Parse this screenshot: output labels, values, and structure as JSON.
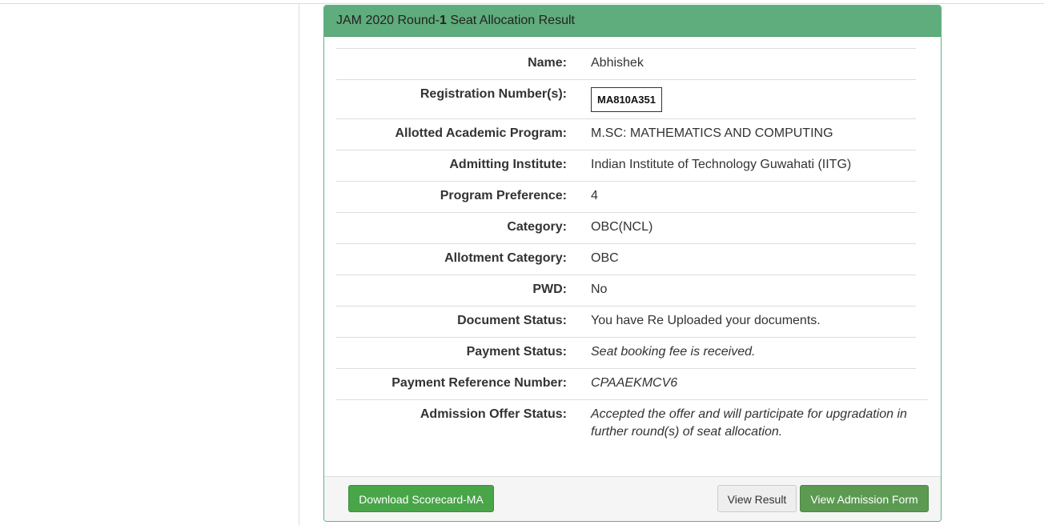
{
  "panel": {
    "title_prefix": "JAM 2020 Round-",
    "title_round": "1",
    "title_suffix": " Seat Allocation Result"
  },
  "fields": {
    "name": {
      "label": "Name:",
      "value": "Abhishek"
    },
    "registration": {
      "label": "Registration Number(s):",
      "value": "MA810A351"
    },
    "program": {
      "label": "Allotted Academic Program:",
      "value": "M.SC: MATHEMATICS AND COMPUTING"
    },
    "institute": {
      "label": "Admitting Institute:",
      "value": "Indian Institute of Technology Guwahati (IITG)"
    },
    "preference": {
      "label": "Program Preference:",
      "value": "4"
    },
    "category": {
      "label": "Category:",
      "value": "OBC(NCL)"
    },
    "allotment_category": {
      "label": "Allotment Category:",
      "value": "OBC"
    },
    "pwd": {
      "label": "PWD:",
      "value": "No"
    },
    "document_status": {
      "label": "Document Status:",
      "value": "You have Re Uploaded your documents."
    },
    "payment_status": {
      "label": "Payment Status:",
      "value": "Seat booking fee is received."
    },
    "payment_reference": {
      "label": "Payment Reference Number:",
      "value": "CPAAEKMCV6"
    },
    "offer_status": {
      "label": "Admission Offer Status:",
      "value": "Accepted the offer and will participate for upgradation in further round(s) of seat allocation."
    }
  },
  "footer": {
    "download_label": "Download Scorecard-MA",
    "view_result_label": "View Result",
    "view_admission_label": "View Admission Form"
  },
  "colors": {
    "heading_bg": "#5fac7c",
    "panel_border": "#5cb380",
    "btn_green": "#48a548",
    "btn_dark_green": "#5c9a52"
  }
}
